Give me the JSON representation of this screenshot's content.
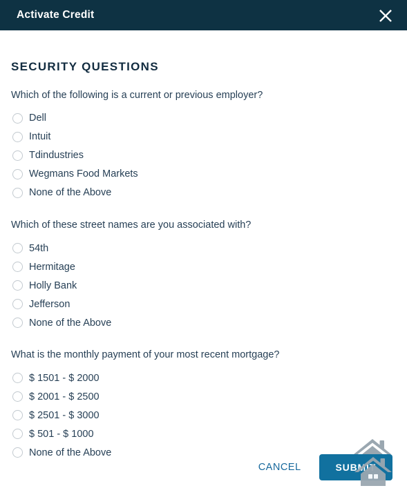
{
  "header": {
    "title": "Activate Credit",
    "close_icon": "close-icon"
  },
  "body": {
    "section_heading": "SECURITY QUESTIONS",
    "questions": [
      {
        "text": "Which of the following is a current or previous employer?",
        "options": [
          "Dell",
          "Intuit",
          "Tdindustries",
          "Wegmans Food Markets",
          "None of the Above"
        ]
      },
      {
        "text": "Which of these street names are you associated with?",
        "options": [
          "54th",
          "Hermitage",
          "Holly Bank",
          "Jefferson",
          "None of the Above"
        ]
      },
      {
        "text": "What is the monthly payment of your most recent mortgage?",
        "options": [
          "$ 1501 - $ 2000",
          "$ 2001 - $ 2500",
          "$ 2501 - $ 3000",
          "$ 501 - $ 1000",
          "None of the Above"
        ]
      }
    ]
  },
  "footer": {
    "cancel_label": "CANCEL",
    "submit_label": "SUBMIT",
    "watermark_icon": "house-icon"
  },
  "colors": {
    "header_bg": "#0e3243",
    "accent_blue": "#11719f",
    "link_blue": "#16689c",
    "text_dark": "#274056",
    "radio_border": "#c2c9cf",
    "house_gray": "#9aa7b0"
  }
}
